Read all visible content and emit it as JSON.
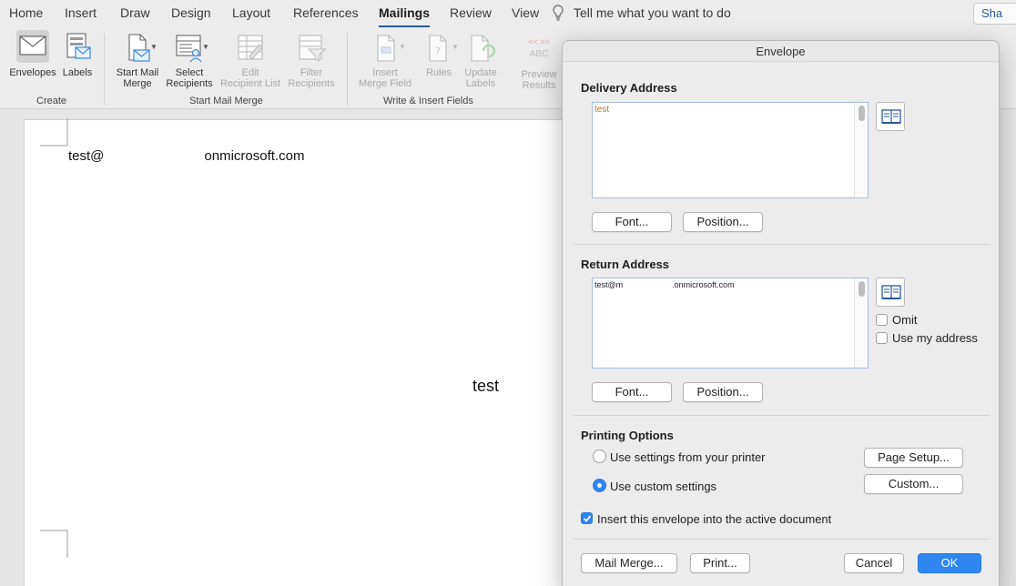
{
  "tabs": [
    "Home",
    "Insert",
    "Draw",
    "Design",
    "Layout",
    "References",
    "Mailings",
    "Review",
    "View"
  ],
  "active_tab": "Mailings",
  "tell_me": "Tell me what you want to do",
  "share_label": "Sha",
  "ribbon": {
    "create": {
      "group_label": "Create",
      "envelopes": "Envelopes",
      "labels": "Labels"
    },
    "start_mail_merge": {
      "group_label": "Start Mail Merge",
      "start_line1": "Start Mail",
      "start_line2": "Merge",
      "select_line1": "Select",
      "select_line2": "Recipients",
      "edit_line1": "Edit",
      "edit_line2": "Recipient List",
      "filter_line1": "Filter",
      "filter_line2": "Recipients"
    },
    "write_insert": {
      "group_label": "Write & Insert Fields",
      "insert_line1": "Insert",
      "insert_line2": "Merge Field",
      "rules": "Rules",
      "update_line1": "Update",
      "update_line2": "Labels"
    },
    "preview": {
      "preview_line1": "Preview",
      "preview_line2": "Results",
      "abc": "ABC"
    }
  },
  "document": {
    "return_address_start": "test@",
    "return_address_end": "onmicrosoft.com",
    "delivery_address": "test"
  },
  "dialog": {
    "title": "Envelope",
    "delivery": {
      "title": "Delivery Address",
      "value": "test",
      "font_button": "Font...",
      "position_button": "Position..."
    },
    "return": {
      "title": "Return Address",
      "value_start": "test@m",
      "value_end": ".onmicrosoft.com",
      "omit_label": "Omit",
      "use_my_address_label": "Use my address",
      "font_button": "Font...",
      "position_button": "Position..."
    },
    "printing": {
      "title": "Printing Options",
      "printer_settings_label": "Use settings from your printer",
      "custom_settings_label": "Use custom settings",
      "page_setup_button": "Page Setup...",
      "custom_button": "Custom..."
    },
    "insert_label": "Insert this envelope into the active document",
    "mail_merge_button": "Mail Merge...",
    "print_button": "Print...",
    "cancel_button": "Cancel",
    "ok_button": "OK"
  },
  "colors": {
    "accent": "#2f86ef",
    "tab_underline": "#2b579a",
    "delivery_text": "#b37a1e"
  }
}
